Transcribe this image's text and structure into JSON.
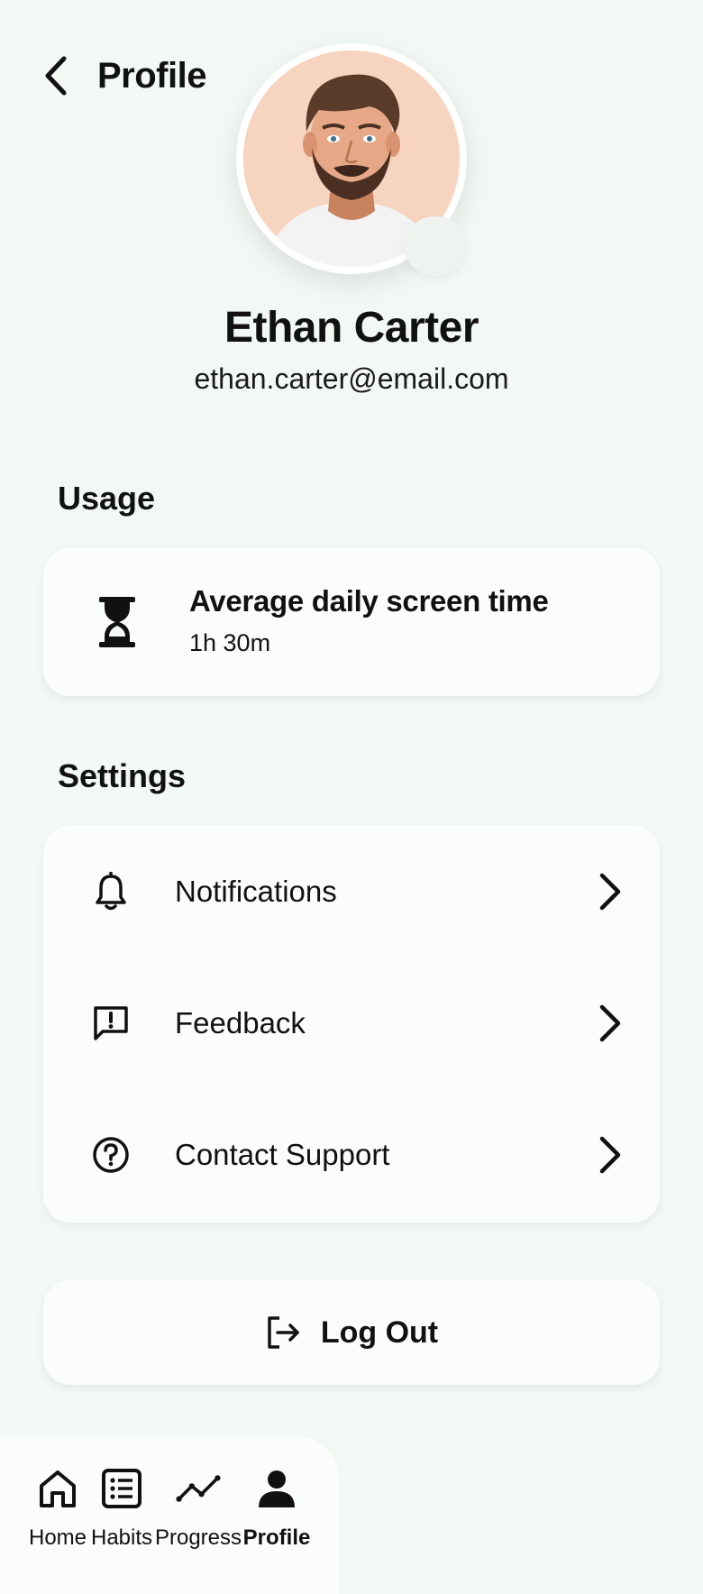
{
  "header": {
    "title": "Profile"
  },
  "user": {
    "name": "Ethan Carter",
    "email": "ethan.carter@email.com"
  },
  "usage": {
    "section_title": "Usage",
    "label": "Average daily screen time",
    "value": "1h 30m",
    "icon": "hourglass-icon"
  },
  "settings": {
    "section_title": "Settings",
    "items": [
      {
        "label": "Notifications",
        "icon": "bell-icon"
      },
      {
        "label": "Feedback",
        "icon": "feedback-icon"
      },
      {
        "label": "Contact Support",
        "icon": "help-circle-icon"
      }
    ]
  },
  "logout": {
    "label": "Log Out",
    "icon": "logout-icon"
  },
  "nav": {
    "items": [
      {
        "label": "Home",
        "icon": "home-icon"
      },
      {
        "label": "Habits",
        "icon": "list-icon"
      },
      {
        "label": "Progress",
        "icon": "trend-icon"
      },
      {
        "label": "Profile",
        "icon": "person-icon",
        "active": true
      }
    ]
  },
  "colors": {
    "background": "#f2f8f4",
    "card": "#fbfdfc",
    "text": "#111111",
    "avatar_bg": "#f6d4bf"
  }
}
